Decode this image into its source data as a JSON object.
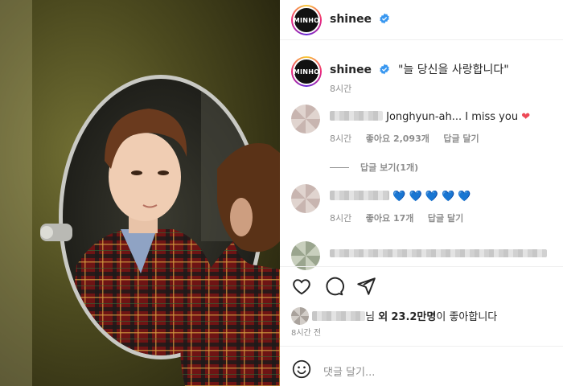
{
  "header": {
    "avatar_text": "MINHO",
    "username": "shinee"
  },
  "caption": {
    "avatar_text": "MINHO",
    "username": "shinee",
    "text": "\"늘 당신을 사랑합니다\"",
    "time": "8시간"
  },
  "comments": [
    {
      "text": "Jonghyun-ah... I miss you",
      "emoji": "❤",
      "time": "8시간",
      "likes": "좋아요 2,093개",
      "reply": "답글 달기",
      "view_replies": "답글 보기(1개)"
    },
    {
      "emoji": "💙 💙 💙 💙 💙",
      "time": "8시간",
      "likes": "좋아요 17개",
      "reply": "답글 달기"
    }
  ],
  "likes_summary": {
    "suffix": "님",
    "middle": "외",
    "count": "23.2만명",
    "tail": "이 좋아합니다"
  },
  "post_time": "8시간 전",
  "add_comment_placeholder": "댓글 달기...",
  "colors": {
    "verified": "#3897f0",
    "heart": "#ed4956",
    "blue_heart": "#3897f0"
  },
  "icons": [
    "verified-badge-icon",
    "heart-icon",
    "comment-icon",
    "share-icon",
    "emoji-icon"
  ]
}
